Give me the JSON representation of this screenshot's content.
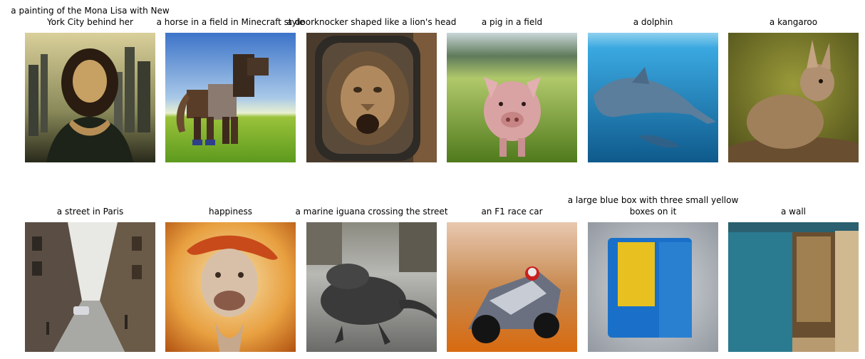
{
  "tiles": [
    {
      "caption": "a painting of the Mona Lisa with New York City behind her",
      "image": "mona-lisa-nyc-image"
    },
    {
      "caption": "a horse in a field in Minecraft style",
      "image": "minecraft-horse-image"
    },
    {
      "caption": "a doorknocker shaped like a lion's head",
      "image": "lion-doorknocker-image"
    },
    {
      "caption": "a pig in a field",
      "image": "pig-in-field-image"
    },
    {
      "caption": "a dolphin",
      "image": "dolphin-image"
    },
    {
      "caption": "a kangaroo",
      "image": "kangaroo-image"
    },
    {
      "caption": "a street in Paris",
      "image": "paris-street-image"
    },
    {
      "caption": "happiness",
      "image": "happiness-image"
    },
    {
      "caption": "a marine iguana crossing the street",
      "image": "marine-iguana-image"
    },
    {
      "caption": "an F1 race car",
      "image": "f1-race-car-image"
    },
    {
      "caption": "a large blue box with three small yellow boxes on it",
      "image": "blue-box-image"
    },
    {
      "caption": "a wall",
      "image": "wall-image"
    }
  ]
}
